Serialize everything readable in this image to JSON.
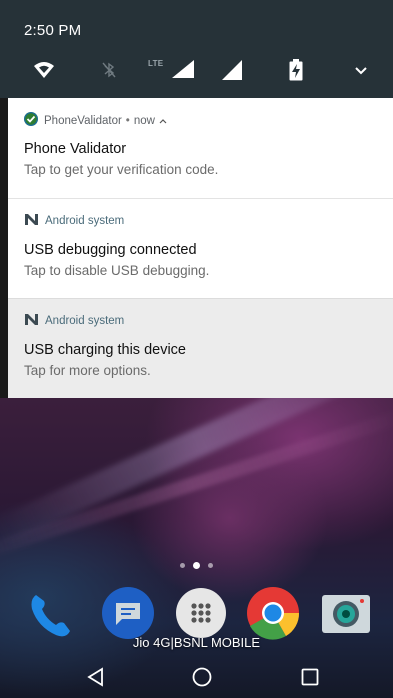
{
  "status_bar": {
    "time": "2:50 PM",
    "network_label": "LTE"
  },
  "quick_settings_icons": [
    {
      "name": "wifi-icon"
    },
    {
      "name": "bluetooth-off-icon"
    },
    {
      "name": "lte-signal-icon"
    },
    {
      "name": "signal-icon"
    },
    {
      "name": "battery-charging-icon"
    },
    {
      "name": "expand-chevron-icon"
    }
  ],
  "notifications": [
    {
      "app_name": "PhoneValidator",
      "separator": "•",
      "time": "now",
      "title": "Phone Validator",
      "body": "Tap to get your verification code."
    },
    {
      "app_name": "Android system",
      "title": "USB debugging connected",
      "body": "Tap to disable USB debugging."
    },
    {
      "app_name": "Android system",
      "title": "USB charging this device",
      "body": "Tap for more options."
    }
  ],
  "home": {
    "carrier": "Jio 4G|BSNL MOBILE",
    "dock_apps": [
      "phone-app-icon",
      "messages-app-icon",
      "app-drawer-icon",
      "chrome-app-icon",
      "camera-app-icon"
    ]
  },
  "colors": {
    "quick_settings_bg": "#263238",
    "notification_bg": "#ffffff",
    "notification_selected_bg": "#ececec"
  }
}
